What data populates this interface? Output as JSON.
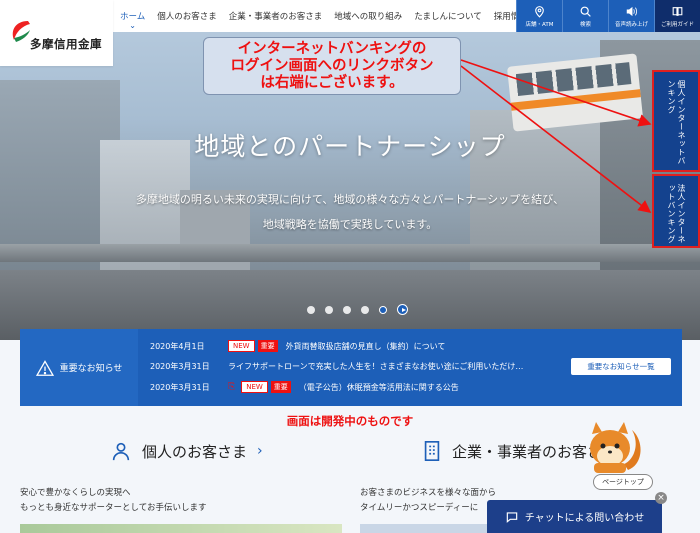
{
  "logo": {
    "text": "多摩信用金庫"
  },
  "nav": [
    "ホーム",
    "個人のお客さま",
    "企業・事業者のお客さま",
    "地域への取り組み",
    "たましんについて",
    "採用情報"
  ],
  "utility": [
    {
      "label": "店舗・ATM",
      "icon": "map-pin-icon"
    },
    {
      "label": "検索",
      "icon": "search-icon"
    },
    {
      "label": "音声読み上げ",
      "icon": "speaker-icon"
    },
    {
      "label": "ご利用ガイド",
      "icon": "book-icon"
    }
  ],
  "hero": {
    "title": "地域とのパートナーシップ",
    "line1": "多摩地域の明るい未来の実現に向けて、地域の様々な方々とパートナーシップを結び、",
    "line2": "地域戦略を協働で実践しています。"
  },
  "annotation": {
    "line1": "インターネットバンキングの",
    "line2": "ログイン画面へのリンクボタン",
    "line3": "は右端にございます。"
  },
  "side": {
    "personal": "個人インターネットバンキング",
    "corporate": "法人インターネットバンキング"
  },
  "notice": {
    "heading": "重要なお知らせ",
    "new_tag": "NEW",
    "important_tag": "重要",
    "items": [
      {
        "date": "2020年4月1日",
        "text": "外貨両替取扱店舗の見直し（集約）について"
      },
      {
        "date": "2020年3月31日",
        "text": "ライフサポートローンで充実した人生を！さまざまなお使い途にご利用いただけ…"
      },
      {
        "date": "2020年3月31日",
        "text": "（電子公告）休眠預金等活用法に関する公告"
      }
    ],
    "all_label": "重要なお知らせ一覧"
  },
  "dev_note": "画面は開発中のものです",
  "sections": {
    "personal": {
      "title": "個人のお客さま",
      "line1": "安心で豊かなくらしの実現へ",
      "line2": "もっとも身近なサポーターとしてお手伝いします"
    },
    "business": {
      "title": "企業・事業者のお客さま",
      "line1": "お客さまのビジネスを様々な面から",
      "line2": "タイムリーかつスピーディーに"
    }
  },
  "page_top": "ページトップ",
  "chat": "チャットによる問い合わせ",
  "colors": {
    "brand_blue": "#1d5fb8",
    "dark_blue": "#14428e",
    "alert_red": "#e11111"
  }
}
